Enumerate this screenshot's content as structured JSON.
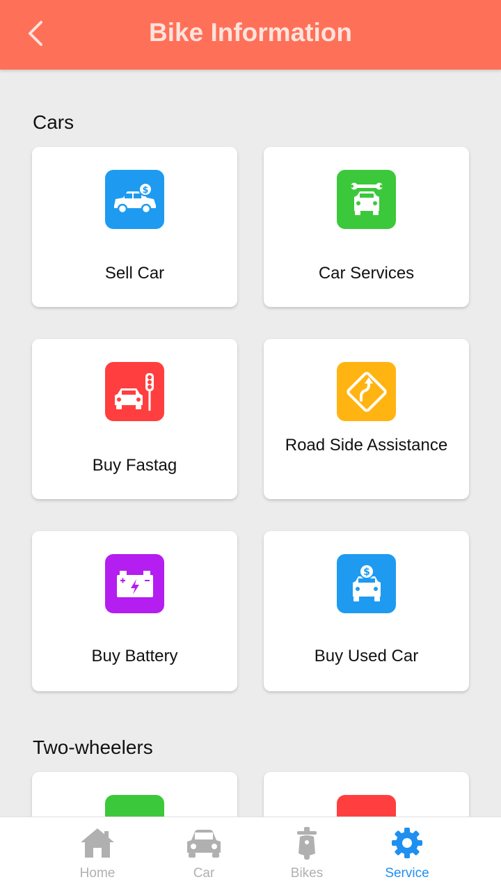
{
  "header": {
    "title": "Bike Information",
    "back_icon": "chevron-left-icon"
  },
  "sections": [
    {
      "title": "Cars",
      "items": [
        {
          "label": "Sell Car",
          "icon": "sell-car-icon",
          "color": "#1e9bf0"
        },
        {
          "label": "Car Services",
          "icon": "car-service-icon",
          "color": "#3bc83b"
        },
        {
          "label": "Buy Fastag",
          "icon": "car-traffic-light-icon",
          "color": "#ff3f3f"
        },
        {
          "label": "Road Side Assistance",
          "icon": "road-sign-icon",
          "color": "#ffb412"
        },
        {
          "label": "Buy Battery",
          "icon": "battery-icon",
          "color": "#b41ef0"
        },
        {
          "label": "Buy Used Car",
          "icon": "used-car-icon",
          "color": "#1e9bf0"
        }
      ]
    },
    {
      "title": "Two-wheelers",
      "items": [
        {
          "label": "",
          "icon": "",
          "color": "#3bc83b"
        },
        {
          "label": "",
          "icon": "",
          "color": "#ff3f3f"
        }
      ]
    }
  ],
  "bottom_nav": [
    {
      "label": "Home",
      "icon": "home-icon",
      "active": false
    },
    {
      "label": "Car",
      "icon": "car-icon",
      "active": false
    },
    {
      "label": "Bikes",
      "icon": "scooter-icon",
      "active": false
    },
    {
      "label": "Service",
      "icon": "gear-icon",
      "active": true
    }
  ],
  "colors": {
    "header": "#ff7059",
    "active_nav": "#1e90ef",
    "inactive_nav": "#b0b0b0",
    "background": "#ececec"
  }
}
